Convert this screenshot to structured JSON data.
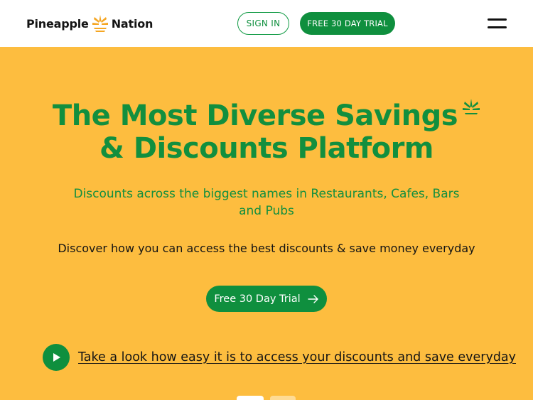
{
  "header": {
    "brand_left": "Pineapple",
    "brand_right": "Nation",
    "signin_label": "SIGN IN",
    "trial_label": "FREE 30 DAY TRIAL"
  },
  "hero": {
    "headline_line1": "The Most Diverse Savings",
    "headline_line2": "& Discounts Platform",
    "subheadline": "Discounts across the biggest names in Restaurants, Cafes, Bars and Pubs",
    "description": "Discover how you can access the best discounts & save money everyday",
    "cta_label": "Free 30 Day Trial",
    "video_link": "Take a look how easy it is to access your discounts and save everyday"
  },
  "colors": {
    "background": "#fdbd3f",
    "brand_green": "#0f8f3e",
    "header_bg": "#ffffff"
  },
  "icons": [
    "pineapple-logo-icon",
    "pineapple-leaf-icon",
    "menu-icon",
    "arrow-right-icon",
    "play-icon"
  ]
}
